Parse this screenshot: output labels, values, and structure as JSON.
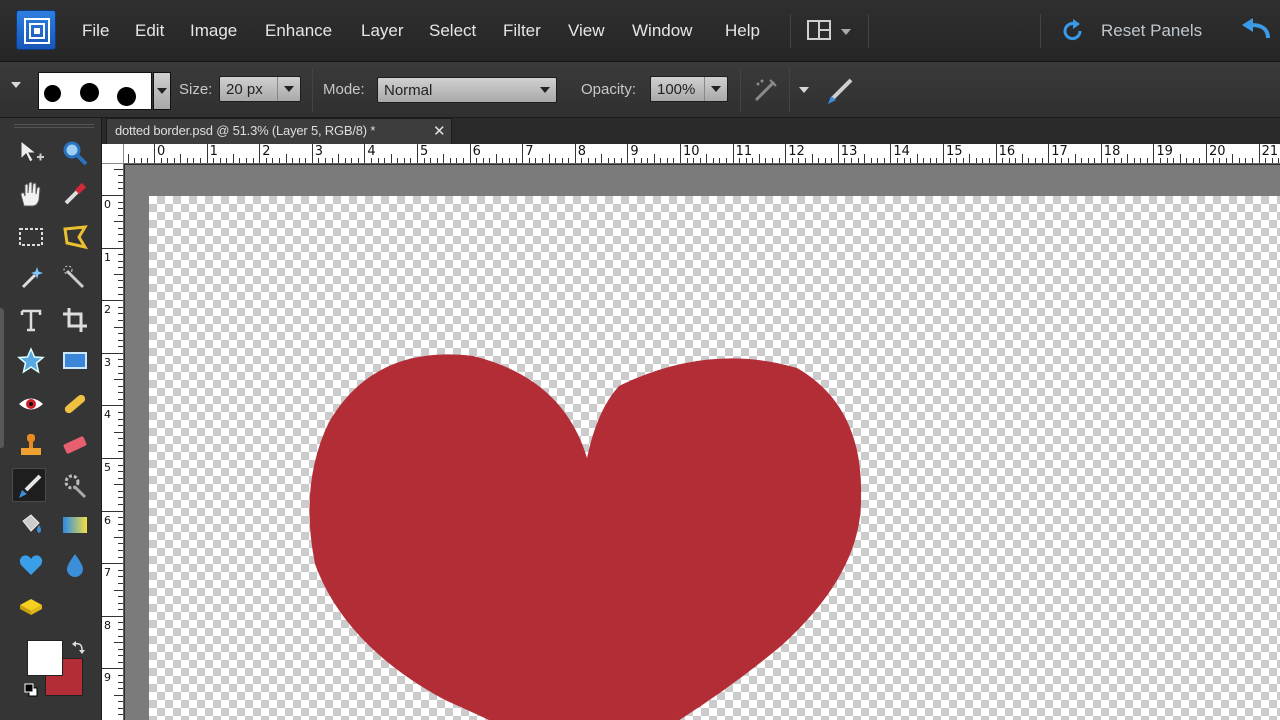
{
  "menu": {
    "items": [
      "File",
      "Edit",
      "Image",
      "Enhance",
      "Layer",
      "Select",
      "Filter",
      "View",
      "Window",
      "Help"
    ],
    "reset_panels": "Reset Panels"
  },
  "options": {
    "size_label": "Size:",
    "size_value": "20 px",
    "mode_label": "Mode:",
    "mode_value": "Normal",
    "opacity_label": "Opacity:",
    "opacity_value": "100%"
  },
  "document": {
    "tab_title": "dotted border.psd @ 51.3% (Layer 5, RGB/8) *",
    "zoom": "51.3%"
  },
  "rulers": {
    "horizontal": [
      "0",
      "1",
      "2",
      "3",
      "4",
      "5",
      "6",
      "7",
      "8",
      "9",
      "10",
      "11",
      "12",
      "13",
      "14",
      "15",
      "16",
      "17",
      "18",
      "19",
      "20",
      "21"
    ],
    "vertical": [
      "0",
      "1",
      "2",
      "3",
      "4",
      "5",
      "6",
      "7",
      "8",
      "9"
    ]
  },
  "colors": {
    "foreground": "#ffffff",
    "background": "#b32d37",
    "heart_fill": "#b32d37"
  },
  "tools": [
    "move-tool",
    "zoom-tool",
    "hand-tool",
    "eyedropper-tool",
    "marquee-tool",
    "lasso-tool",
    "magic-wand-tool",
    "quick-selection-tool",
    "type-tool",
    "crop-tool",
    "cookie-cutter-tool",
    "straighten-tool",
    "red-eye-tool",
    "healing-brush-tool",
    "clone-stamp-tool",
    "eraser-tool",
    "brush-tool",
    "smart-brush-tool",
    "paint-bucket-tool",
    "gradient-tool",
    "custom-shape-tool",
    "blur-tool",
    "sponge-tool"
  ]
}
